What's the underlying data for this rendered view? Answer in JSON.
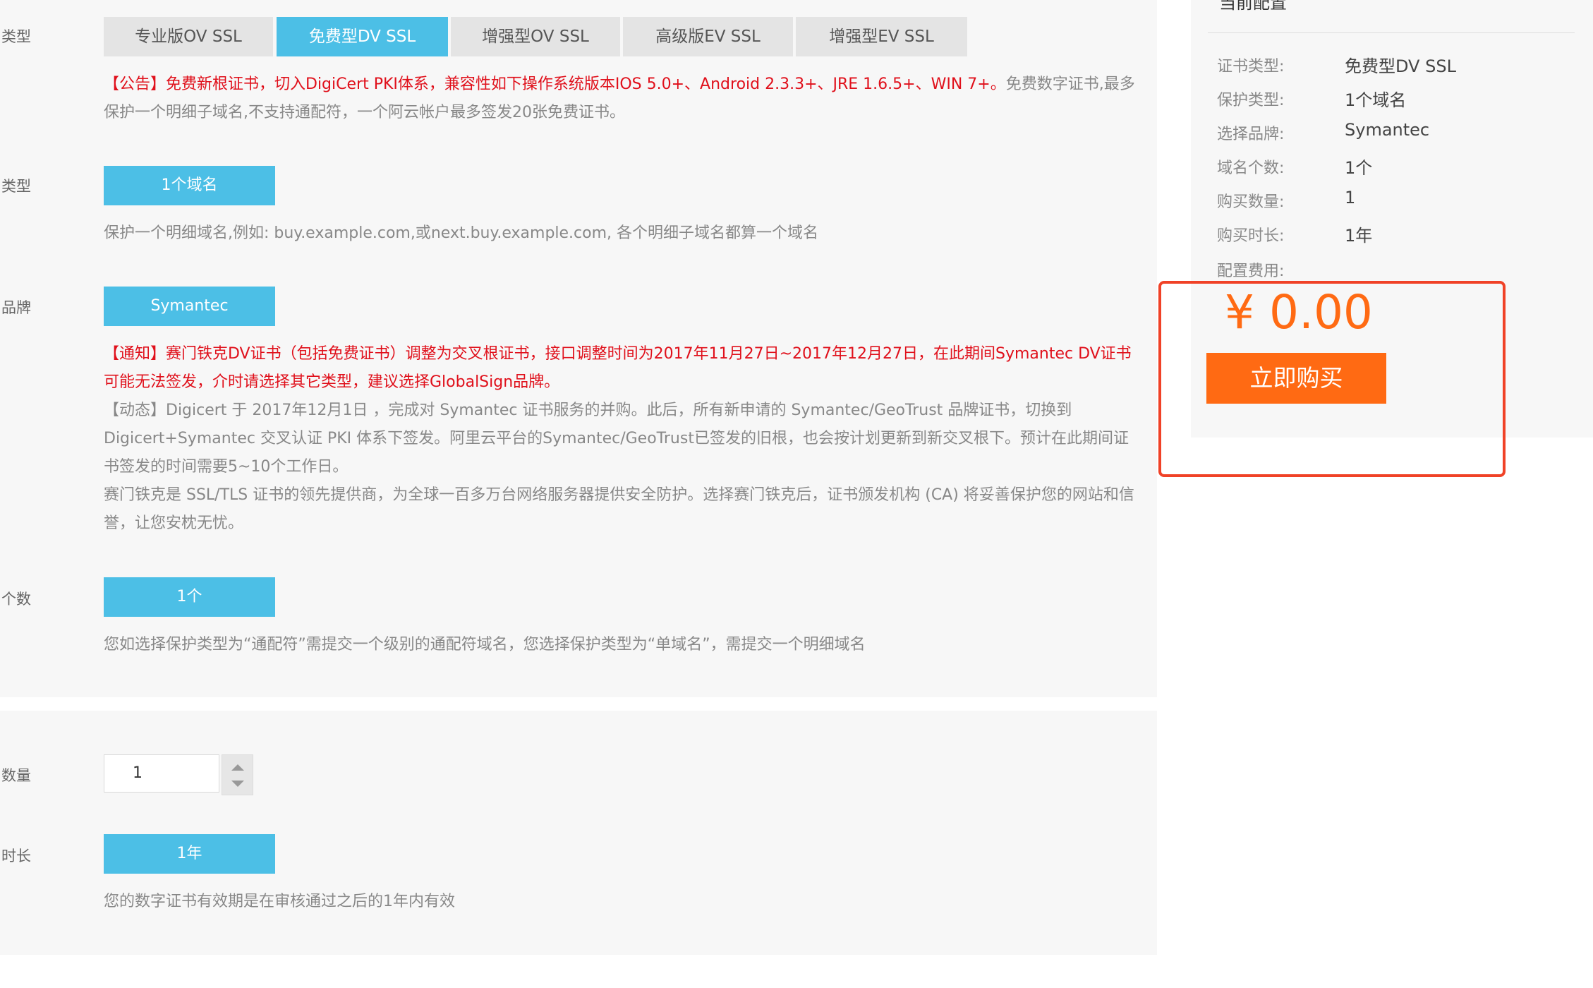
{
  "config": {
    "tabs_label": "类型",
    "tabs": [
      {
        "label": "专业版OV SSL",
        "active": false
      },
      {
        "label": "免费型DV SSL",
        "active": true
      },
      {
        "label": "增强型OV SSL",
        "active": false
      },
      {
        "label": "高级版EV SSL",
        "active": false
      },
      {
        "label": "增强型EV SSL",
        "active": false
      }
    ],
    "announcement_red": "【公告】免费新根证书，切入DigiCert PKI体系，兼容性如下操作系统版本IOS 5.0+、Android 2.3.3+、JRE 1.6.5+、WIN 7+。",
    "announcement_gray": "免费数字证书,最多保护一个明细子域名,不支持通配符，一个阿云帐户最多签发20张免费证书。",
    "protect": {
      "label": "类型",
      "option": "1个域名",
      "desc": "保护一个明细域名,例如: buy.example.com,或next.buy.example.com, 各个明细子域名都算一个域名"
    },
    "brand": {
      "label": "品牌",
      "option": "Symantec",
      "notice_red": "【通知】赛门铁克DV证书（包括免费证书）调整为交叉根证书，接口调整时间为2017年11月27日~2017年12月27日，在此期间Symantec DV证书可能无法签发，介时请选择其它类型，建议选择GlobalSign品牌。",
      "dynamic": "【动态】Digicert 于 2017年12月1日 ，完成对 Symantec 证书服务的并购。此后，所有新申请的 Symantec/GeoTrust 品牌证书，切换到 Digicert+Symantec 交叉认证 PKI 体系下签发。阿里云平台的Symantec/GeoTrust已签发的旧根，也会按计划更新到新交叉根下。预计在此期间证书签发的时间需要5~10个工作日。",
      "intro": "赛门铁克是 SSL/TLS 证书的领先提供商，为全球一百多万台网络服务器提供安全防护。选择赛门铁克后，证书颁发机构 (CA) 将妥善保护您的网站和信誉，让您安枕无忧。"
    },
    "count": {
      "label": "个数",
      "option": "1个",
      "desc": "您如选择保护类型为“通配符”需提交一个级别的通配符域名，您选择保护类型为“单域名”，需提交一个明细域名"
    }
  },
  "purchase": {
    "quantity_label": "数量",
    "quantity_value": "1",
    "duration_label": "时长",
    "duration_option": "1年",
    "duration_desc": "您的数字证书有效期是在审核通过之后的1年内有效"
  },
  "summary": {
    "title": "当前配置",
    "rows": [
      {
        "label": "证书类型:",
        "value": "免费型DV SSL"
      },
      {
        "label": "保护类型:",
        "value": "1个域名"
      },
      {
        "label": "选择品牌:",
        "value": "Symantec"
      },
      {
        "label": "域名个数:",
        "value": "1个"
      },
      {
        "label": "购买数量:",
        "value": "1"
      },
      {
        "label": "购买时长:",
        "value": "1年"
      }
    ],
    "fee_label": "配置费用:",
    "price": "¥ 0.00",
    "buy_button": "立即购买"
  },
  "colors": {
    "active_tab": "#4cbfe6",
    "buy_button": "#ff6a13",
    "notice_red": "#e0101b",
    "highlight_border": "#f04227"
  }
}
